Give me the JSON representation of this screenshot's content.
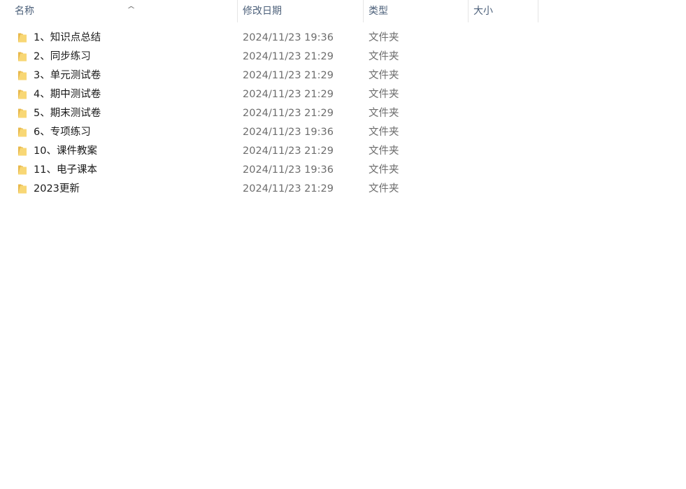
{
  "columns": {
    "name": "名称",
    "date": "修改日期",
    "type": "类型",
    "size": "大小",
    "sort_indicator": "^"
  },
  "items": [
    {
      "name": "1、知识点总结",
      "date": "2024/11/23 19:36",
      "type": "文件夹",
      "icon": "folder-icon"
    },
    {
      "name": "2、同步练习",
      "date": "2024/11/23 21:29",
      "type": "文件夹",
      "icon": "folder-icon"
    },
    {
      "name": "3、单元测试卷",
      "date": "2024/11/23 21:29",
      "type": "文件夹",
      "icon": "folder-icon"
    },
    {
      "name": "4、期中测试卷",
      "date": "2024/11/23 21:29",
      "type": "文件夹",
      "icon": "folder-icon"
    },
    {
      "name": "5、期末测试卷",
      "date": "2024/11/23 21:29",
      "type": "文件夹",
      "icon": "folder-icon"
    },
    {
      "name": "6、专项练习",
      "date": "2024/11/23 19:36",
      "type": "文件夹",
      "icon": "folder-icon"
    },
    {
      "name": "10、课件教案",
      "date": "2024/11/23 21:29",
      "type": "文件夹",
      "icon": "folder-icon"
    },
    {
      "name": "11、电子课本",
      "date": "2024/11/23 19:36",
      "type": "文件夹",
      "icon": "folder-icon"
    },
    {
      "name": "2023更新",
      "date": "2024/11/23 21:29",
      "type": "文件夹",
      "icon": "folder-icon"
    }
  ],
  "colors": {
    "folder_front": "#f8d775",
    "folder_back": "#e8b84a"
  }
}
